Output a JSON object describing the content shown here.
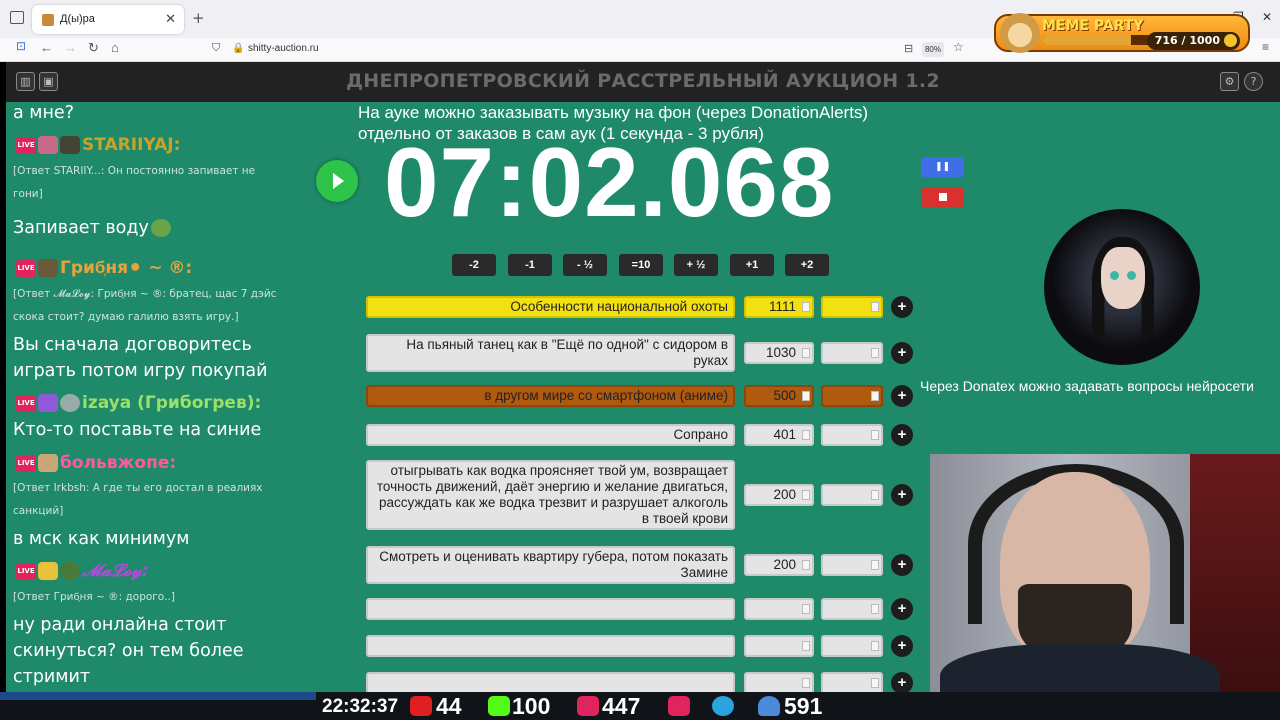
{
  "browser": {
    "tab_title": "Д(ы)ра",
    "url": "shitty-auction.ru",
    "zoom": "80%"
  },
  "meme_party": {
    "title": "MEME PARTY",
    "count": "716 / 1000",
    "progress": 0.716
  },
  "app": {
    "title": "ДНЕПРОПЕТРОВСКИЙ РАССТРЕЛЬНЫЙ АУКЦИОН 1.2"
  },
  "chat": [
    {
      "text": "а мне?"
    },
    {
      "nick": "STARIIYAJ:",
      "color": "#c9a227"
    },
    {
      "reply": "[Ответ STARIIY...: Он постоянно запивает не"
    },
    {
      "reply2": "гони]"
    },
    {
      "text": "Запивает воду"
    },
    {
      "nick": "Гриб᷊ня⚫ ~ ®:",
      "color": "#e8a33a"
    },
    {
      "reply": "[Ответ 𝓜𝓪𝓛𝓸𝔂: Гриб᷊ня ~ ®: братец, щас 7 дэйс"
    },
    {
      "reply2": "скока стоит? думаю галилю взять игру.]"
    },
    {
      "text": "Вы сначала договоритесь"
    },
    {
      "text2": "играть потом игру покупай"
    },
    {
      "nick": "izaya (Грибогрев):",
      "color": "#9be06a"
    },
    {
      "text": "Кто-то поставьте на синие"
    },
    {
      "nick": "больвжопе:",
      "color": "#ff5aa0"
    },
    {
      "reply": "[Ответ Irkbsh: А где ты его достал в реалиях"
    },
    {
      "reply2": "санкций]"
    },
    {
      "text": "в мск как минимум"
    },
    {
      "nick": "𝓜𝓪𝓛𝓸𝔂:",
      "color": "#b04ad9"
    },
    {
      "reply": "[Ответ Гриб᷊ня ~ ®: дорого..]"
    },
    {
      "text": "ну ради онлайна стоит"
    },
    {
      "text2": "скинуться? он тем более"
    },
    {
      "text3": "стримит"
    }
  ],
  "info_line1": "На ауке можно заказывать музыку на фон (через DonationAlerts)",
  "info_line2": "отдельно от заказов в сам аук (1 секунда - 3 рубля)",
  "timer": "07:02.068",
  "adjust_buttons": [
    "-2",
    "-1",
    "- ½",
    "=10",
    "+ ½",
    "+1",
    "+2"
  ],
  "lots": [
    {
      "name": "Особенности национальной охоты",
      "amount": "1111",
      "color": "#f2e010",
      "border": "#d4c200"
    },
    {
      "name": "На пьяный танец как в \"Ещё по одной\" с сидором в руках",
      "amount": "1030",
      "color": "#e4e4e4",
      "border": "#c8c8c8"
    },
    {
      "name": "в другом мире со смартфоном (аниме)",
      "amount": "500",
      "color": "#b05a10",
      "border": "#8e460a"
    },
    {
      "name": "Сопрано",
      "amount": "401",
      "color": "#e4e4e4",
      "border": "#c8c8c8"
    },
    {
      "name": "отыгрывать как водка проясняет твой ум, возвращает точность движений, даёт энергию и желание двигаться, рассуждать как же водка трезвит и разрушает алкоголь в твоей крови",
      "amount": "200",
      "color": "#e4e4e4",
      "border": "#c8c8c8"
    },
    {
      "name": "Смотреть и оценивать квартиру губера, потом показать Замине",
      "amount": "200",
      "color": "#e4e4e4",
      "border": "#c8c8c8"
    },
    {
      "name": "",
      "amount": "",
      "color": "#e4e4e4",
      "border": "#c8c8c8"
    },
    {
      "name": "",
      "amount": "",
      "color": "#e4e4e4",
      "border": "#c8c8c8"
    },
    {
      "name": "",
      "amount": "",
      "color": "#e4e4e4",
      "border": "#c8c8c8"
    }
  ],
  "donatex_text": "Через Donatex можно задавать вопросы нейросети",
  "status": {
    "time": "22:32:37",
    "youtube": "44",
    "kick": "100",
    "vk": "447",
    "users": "591"
  }
}
